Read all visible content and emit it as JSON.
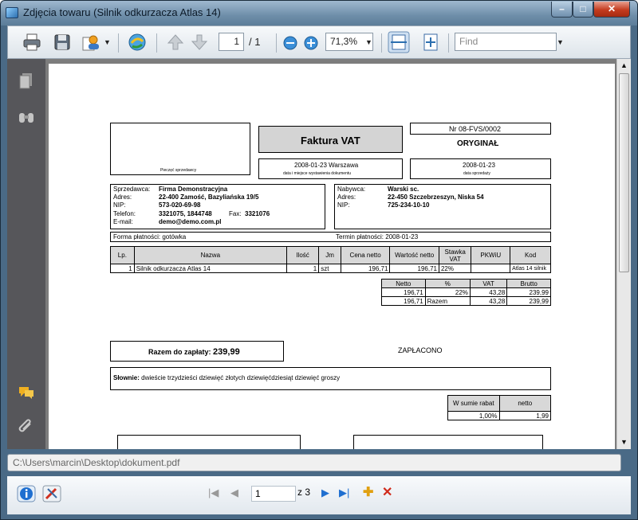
{
  "window": {
    "title": "Zdjęcia towaru (Silnik odkurzacza Atlas 14)"
  },
  "toolbar": {
    "page_current": "1",
    "page_total": "/ 1",
    "zoom": "71,3%",
    "find_placeholder": "Find"
  },
  "invoice": {
    "seal_label": "Pieczęć sprzedawcy",
    "title": "Faktura VAT",
    "number": "Nr 08-FVS/0002",
    "original": "ORYGINAŁ",
    "issue_date_place": "2008-01-23 Warszawa",
    "issue_caption": "data i miejsce wystawienia dokumentu",
    "sale_date": "2008-01-23",
    "sale_caption": "data sprzedaży",
    "seller": {
      "l1": "Sprzedawca:",
      "v1": "Firma Demonstracyjna",
      "l2": "Adres:",
      "v2": "22-400 Zamość, Bazyliańska 19/5",
      "l3": "NIP:",
      "v3": "573-020-69-98",
      "l4": "Telefon:",
      "v4": "3321075, 1844748",
      "fax_label": "Fax:",
      "fax": "3321076",
      "l5": "E-mail:",
      "v5": "demo@demo.com.pl"
    },
    "buyer": {
      "l1": "Nabywca:",
      "v1": "Warski sc.",
      "l2": "Adres:",
      "v2": "22-450 Szczebrzeszyn, Niska 54",
      "l3": "NIP:",
      "v3": "725-234-10-10"
    },
    "payment_form": "Forma płatności: gotówka",
    "payment_term": "Termin płatności: 2008-01-23",
    "items_header": [
      "Lp.",
      "Nazwa",
      "Ilość",
      "Jm",
      "Cena netto",
      "Wartość netto",
      "Stawka VAT",
      "PKWiU",
      "Kod"
    ],
    "items": [
      [
        "1",
        "Silnik odkurzacza Atlas 14",
        "1",
        "szt",
        "196,71",
        "196,71",
        "22%",
        "",
        "Atlas 14 silnik"
      ]
    ],
    "summary_header": [
      "Netto",
      "%",
      "VAT",
      "Brutto"
    ],
    "summary_rows": [
      [
        "196,71",
        "22%",
        "43,28",
        "239,99"
      ],
      [
        "196,71",
        "Razem",
        "43,28",
        "239,99"
      ]
    ],
    "total_label": "Razem do zapłaty:",
    "total_value": "239,99",
    "paid": "ZAPŁACONO",
    "words_label": "Słownie:",
    "words_value": "dwieście trzydzieści dziewięć złotych dziewięćdziesiąt dziewięć groszy",
    "discount_header": [
      "W sumie rabat",
      "netto"
    ],
    "discount_row": [
      "1,00%",
      "1,99"
    ]
  },
  "path": {
    "value": "C:\\Users\\marcin\\Desktop\\dokument.pdf"
  },
  "bottom_nav": {
    "current": "1",
    "of_total": "z 3"
  }
}
